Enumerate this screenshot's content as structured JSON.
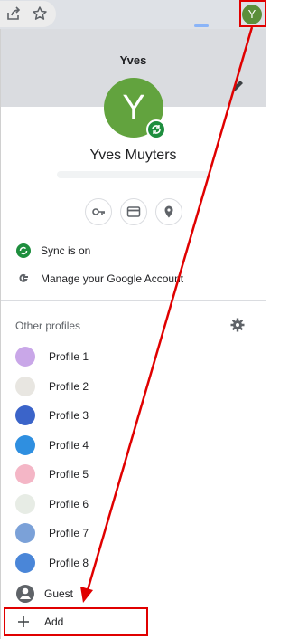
{
  "toolbar": {
    "avatar_letter": "Y",
    "icons": [
      "share-icon",
      "star-icon"
    ]
  },
  "profile": {
    "short_name": "Yves",
    "full_name": "Yves Muyters",
    "avatar_letter": "Y",
    "avatar_color": "#62a33e",
    "banner_color": "#dadce0"
  },
  "quick_actions": [
    "key-icon",
    "credit-card-icon",
    "location-pin-icon"
  ],
  "account": {
    "sync_label": "Sync is on",
    "manage_label": "Manage your Google Account"
  },
  "other_profiles": {
    "title": "Other profiles",
    "items": [
      {
        "label": "Profile 1",
        "color": "#c9a7e8"
      },
      {
        "label": "Profile 2",
        "color": "#e8e6e1"
      },
      {
        "label": "Profile 3",
        "color": "#3b64c9"
      },
      {
        "label": "Profile 4",
        "color": "#2f8fe0"
      },
      {
        "label": "Profile 5",
        "color": "#f4b6c6"
      },
      {
        "label": "Profile 6",
        "color": "#e7ece5"
      },
      {
        "label": "Profile 7",
        "color": "#7ba1d8"
      },
      {
        "label": "Profile 8",
        "color": "#4a86d8"
      }
    ],
    "guest_label": "Guest",
    "add_label": "Add"
  },
  "annotation": {
    "color": "#e00000"
  }
}
